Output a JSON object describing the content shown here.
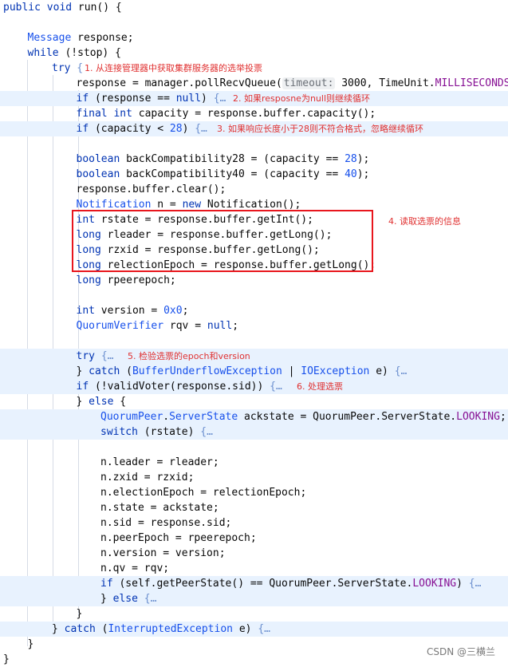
{
  "editor": {
    "lines": [
      {
        "segments": [
          {
            "t": "public",
            "c": "kw"
          },
          {
            "t": " "
          },
          {
            "t": "void",
            "c": "kw"
          },
          {
            "t": " run() {"
          }
        ]
      },
      {
        "segments": []
      },
      {
        "segments": [
          {
            "t": "Message",
            "c": "type"
          },
          {
            "t": " response;"
          }
        ]
      },
      {
        "segments": [
          {
            "t": "while",
            "c": "kw"
          },
          {
            "t": " (!stop) {"
          }
        ]
      },
      {
        "segments": [
          {
            "t": "try",
            "c": "kw"
          },
          {
            "t": " {",
            "c": "fold"
          }
        ],
        "note": "1. 从连接管理器中获取集群服务器的选举投票"
      },
      {
        "segments": [
          {
            "t": "response = manager.pollRecvQueue("
          },
          {
            "t": "timeout:",
            "c": "hint"
          },
          {
            "t": " 3000, TimeUnit."
          },
          {
            "t": "MILLISECONDS",
            "c": "const"
          },
          {
            "t": ");"
          }
        ]
      },
      {
        "segments": [
          {
            "t": "if",
            "c": "kw"
          },
          {
            "t": " (response == "
          },
          {
            "t": "null",
            "c": "kw"
          },
          {
            "t": ") "
          },
          {
            "t": "{…",
            "c": "fold"
          }
        ],
        "note": "2. 如果resposne为null则继续循环"
      },
      {
        "segments": [
          {
            "t": "final",
            "c": "kw"
          },
          {
            "t": " "
          },
          {
            "t": "int",
            "c": "kw"
          },
          {
            "t": " capacity = response.buffer.capacity();"
          }
        ]
      },
      {
        "segments": [
          {
            "t": "if",
            "c": "kw"
          },
          {
            "t": " (capacity < "
          },
          {
            "t": "28",
            "c": "num"
          },
          {
            "t": ") "
          },
          {
            "t": "{…",
            "c": "fold"
          }
        ],
        "note": "3. 如果响应长度小于28则不符合格式，忽略继续循环"
      },
      {
        "segments": []
      },
      {
        "segments": [
          {
            "t": "boolean",
            "c": "kw"
          },
          {
            "t": " backCompatibility28 = (capacity == "
          },
          {
            "t": "28",
            "c": "num"
          },
          {
            "t": ");"
          }
        ]
      },
      {
        "segments": [
          {
            "t": "boolean",
            "c": "kw"
          },
          {
            "t": " backCompatibility40 = (capacity == "
          },
          {
            "t": "40",
            "c": "num"
          },
          {
            "t": ");"
          }
        ]
      },
      {
        "segments": [
          {
            "t": "response.buffer.clear();"
          }
        ]
      },
      {
        "segments": [
          {
            "t": "Notification",
            "c": "type"
          },
          {
            "t": " n = "
          },
          {
            "t": "new",
            "c": "kw"
          },
          {
            "t": " Notification();"
          }
        ]
      },
      {
        "segments": [
          {
            "t": "int",
            "c": "kw"
          },
          {
            "t": " rstate = response.buffer.getInt();"
          }
        ]
      },
      {
        "segments": [
          {
            "t": "long",
            "c": "kw"
          },
          {
            "t": " rleader = response.buffer.getLong();"
          }
        ]
      },
      {
        "segments": [
          {
            "t": "long",
            "c": "kw"
          },
          {
            "t": " rzxid = response.buffer.getLong();"
          }
        ]
      },
      {
        "segments": [
          {
            "t": "long",
            "c": "kw"
          },
          {
            "t": " relectionEpoch = response.buffer.getLong();"
          }
        ]
      },
      {
        "segments": [
          {
            "t": "long",
            "c": "kw"
          },
          {
            "t": " rpeerepoch;"
          }
        ]
      },
      {
        "segments": []
      },
      {
        "segments": [
          {
            "t": "int",
            "c": "kw"
          },
          {
            "t": " version = "
          },
          {
            "t": "0x0",
            "c": "num"
          },
          {
            "t": ";"
          }
        ]
      },
      {
        "segments": [
          {
            "t": "QuorumVerifier",
            "c": "type"
          },
          {
            "t": " rqv = "
          },
          {
            "t": "null",
            "c": "kw"
          },
          {
            "t": ";"
          }
        ]
      },
      {
        "segments": []
      },
      {
        "segments": [
          {
            "t": "try",
            "c": "kw"
          },
          {
            "t": " "
          },
          {
            "t": "{…",
            "c": "fold"
          }
        ],
        "note": "5. 检验选票的epoch和version"
      },
      {
        "segments": [
          {
            "t": "} "
          },
          {
            "t": "catch",
            "c": "kw"
          },
          {
            "t": " ("
          },
          {
            "t": "BufferUnderflowException",
            "c": "type"
          },
          {
            "t": " | "
          },
          {
            "t": "IOException",
            "c": "type"
          },
          {
            "t": " e) "
          },
          {
            "t": "{…",
            "c": "fold"
          }
        ]
      },
      {
        "segments": [
          {
            "t": "if",
            "c": "kw"
          },
          {
            "t": " (!validVoter(response.sid)) "
          },
          {
            "t": "{…",
            "c": "fold"
          }
        ],
        "note": "6. 处理选票"
      },
      {
        "segments": [
          {
            "t": "} "
          },
          {
            "t": "else",
            "c": "kw"
          },
          {
            "t": " {"
          }
        ]
      },
      {
        "segments": [
          {
            "t": "QuorumPeer",
            "c": "type"
          },
          {
            "t": "."
          },
          {
            "t": "ServerState",
            "c": "type"
          },
          {
            "t": " ackstate = QuorumPeer.ServerState."
          },
          {
            "t": "LOOKING",
            "c": "const"
          },
          {
            "t": ";"
          }
        ]
      },
      {
        "segments": [
          {
            "t": "switch",
            "c": "kw"
          },
          {
            "t": " (rstate) "
          },
          {
            "t": "{…",
            "c": "fold"
          }
        ]
      },
      {
        "segments": []
      },
      {
        "segments": [
          {
            "t": "n.leader = rleader;"
          }
        ]
      },
      {
        "segments": [
          {
            "t": "n.zxid = rzxid;"
          }
        ]
      },
      {
        "segments": [
          {
            "t": "n.electionEpoch = relectionEpoch;"
          }
        ]
      },
      {
        "segments": [
          {
            "t": "n.state = ackstate;"
          }
        ]
      },
      {
        "segments": [
          {
            "t": "n.sid = response.sid;"
          }
        ]
      },
      {
        "segments": [
          {
            "t": "n.peerEpoch = rpeerepoch;"
          }
        ]
      },
      {
        "segments": [
          {
            "t": "n.version = version;"
          }
        ]
      },
      {
        "segments": [
          {
            "t": "n.qv = rqv;"
          }
        ]
      },
      {
        "segments": [
          {
            "t": "if",
            "c": "kw"
          },
          {
            "t": " (self.getPeerState() == QuorumPeer.ServerState."
          },
          {
            "t": "LOOKING",
            "c": "const"
          },
          {
            "t": ") "
          },
          {
            "t": "{…",
            "c": "fold"
          }
        ]
      },
      {
        "segments": [
          {
            "t": "} "
          },
          {
            "t": "else",
            "c": "kw"
          },
          {
            "t": " "
          },
          {
            "t": "{…",
            "c": "fold"
          }
        ]
      },
      {
        "segments": [
          {
            "t": "}"
          }
        ]
      },
      {
        "segments": [
          {
            "t": "} "
          },
          {
            "t": "catch",
            "c": "kw"
          },
          {
            "t": " ("
          },
          {
            "t": "InterruptedException",
            "c": "type"
          },
          {
            "t": " e) "
          },
          {
            "t": "{…",
            "c": "fold"
          }
        ]
      },
      {
        "segments": [
          {
            "t": "}"
          }
        ]
      },
      {
        "segments": [
          {
            "t": "}"
          }
        ]
      }
    ]
  },
  "annotation_4": "4. 读取选票的信息",
  "watermark": "CSDN @三横兰",
  "colors": {
    "keyword": "#0033b3",
    "type": "#1750eb",
    "constant": "#871094",
    "annotation": "#e03131",
    "highlight": "#e8f2fe",
    "box": "#e8161d"
  }
}
